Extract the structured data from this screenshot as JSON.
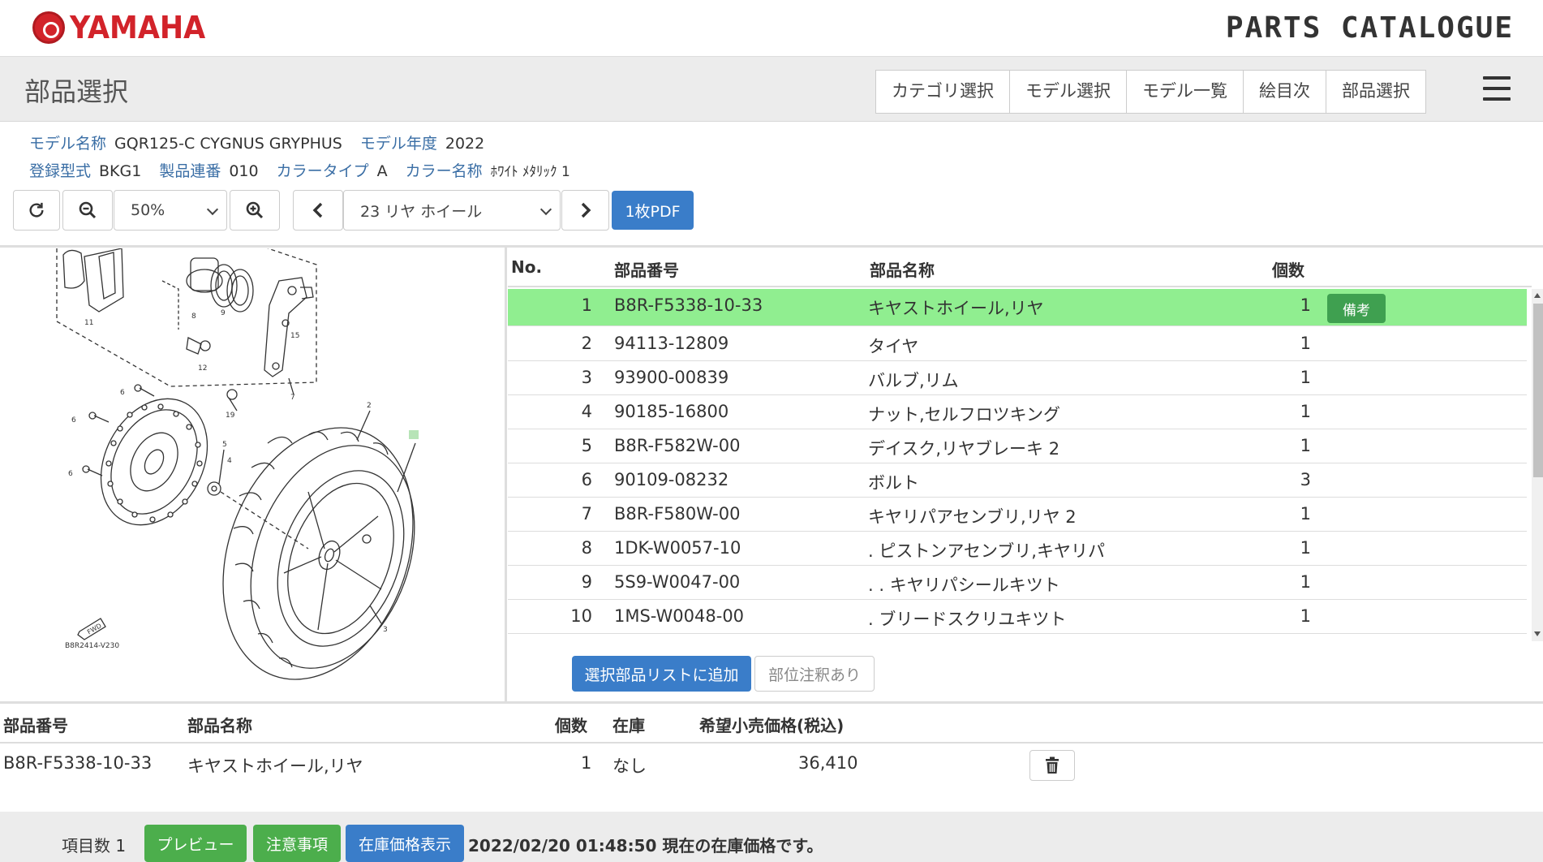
{
  "header": {
    "brand": "YAMAHA",
    "catalogue_title": "PARTS CATALOGUE"
  },
  "titlebar": {
    "title": "部品選択",
    "nav": [
      "カテゴリ選択",
      "モデル選択",
      "モデル一覧",
      "絵目次",
      "部品選択"
    ]
  },
  "model_info": {
    "model_name_label": "モデル名称",
    "model_name": "GQR125-C CYGNUS GRYPHUS",
    "model_year_label": "モデル年度",
    "model_year": "2022",
    "reg_type_label": "登録型式",
    "reg_type": "BKG1",
    "serial_label": "製品連番",
    "serial": "010",
    "color_type_label": "カラータイプ",
    "color_type": "A",
    "color_name_label": "カラー名称",
    "color_name": "ﾎﾜｲﾄ ﾒﾀﾘｯｸ 1"
  },
  "toolbar": {
    "zoom": "50%",
    "figure": "23 リヤ ホイール",
    "pdf_button": "1枚PDF"
  },
  "diagram": {
    "code": "B8R2414-V230",
    "fwd": "FWD",
    "callouts": [
      "11",
      "8",
      "9",
      "15",
      "12",
      "7",
      "6",
      "19",
      "2",
      "1",
      "6",
      "5",
      "6",
      "4",
      "3"
    ]
  },
  "parts_table": {
    "headers": {
      "no": "No.",
      "part_number": "部品番号",
      "part_name": "部品名称",
      "qty": "個数"
    },
    "remark_button": "備考",
    "rows": [
      {
        "no": "1",
        "part_number": "B8R-F5338-10-33",
        "part_name": "キヤストホイール,リヤ",
        "qty": "1",
        "selected": true
      },
      {
        "no": "2",
        "part_number": "94113-12809",
        "part_name": "タイヤ",
        "qty": "1"
      },
      {
        "no": "3",
        "part_number": "93900-00839",
        "part_name": "バルブ,リム",
        "qty": "1"
      },
      {
        "no": "4",
        "part_number": "90185-16800",
        "part_name": "ナット,セルフロツキング",
        "qty": "1"
      },
      {
        "no": "5",
        "part_number": "B8R-F582W-00",
        "part_name": "デイスク,リヤブレーキ 2",
        "qty": "1"
      },
      {
        "no": "6",
        "part_number": "90109-08232",
        "part_name": "ボルト",
        "qty": "3"
      },
      {
        "no": "7",
        "part_number": "B8R-F580W-00",
        "part_name": "キヤリパアセンブリ,リヤ 2",
        "qty": "1"
      },
      {
        "no": "8",
        "part_number": "1DK-W0057-10",
        "part_name": ". ピストンアセンブリ,キヤリパ",
        "qty": "1"
      },
      {
        "no": "9",
        "part_number": "5S9-W0047-00",
        "part_name": ". . キヤリパシールキツト",
        "qty": "1"
      },
      {
        "no": "10",
        "part_number": "1MS-W0048-00",
        "part_name": ". ブリードスクリユキツト",
        "qty": "1"
      }
    ],
    "add_button": "選択部品リストに追加",
    "annotation_button": "部位注釈あり"
  },
  "selected_list": {
    "headers": {
      "part_number": "部品番号",
      "part_name": "部品名称",
      "qty": "個数",
      "stock": "在庫",
      "price": "希望小売価格(税込)"
    },
    "rows": [
      {
        "part_number": "B8R-F5338-10-33",
        "part_name": "キヤストホイール,リヤ",
        "qty": "1",
        "stock": "なし",
        "price": "36,410"
      }
    ]
  },
  "footer": {
    "count_label": "項目数 1",
    "preview": "プレビュー",
    "notice": "注意事項",
    "stock_price": "在庫価格表示",
    "message": "2022/02/20 01:48:50 現在の在庫価格です。"
  },
  "colors": {
    "selected_row": "#90ee90",
    "primary": "#3a7dc9",
    "success": "#4cae4c",
    "brand_red": "#d2232a"
  }
}
